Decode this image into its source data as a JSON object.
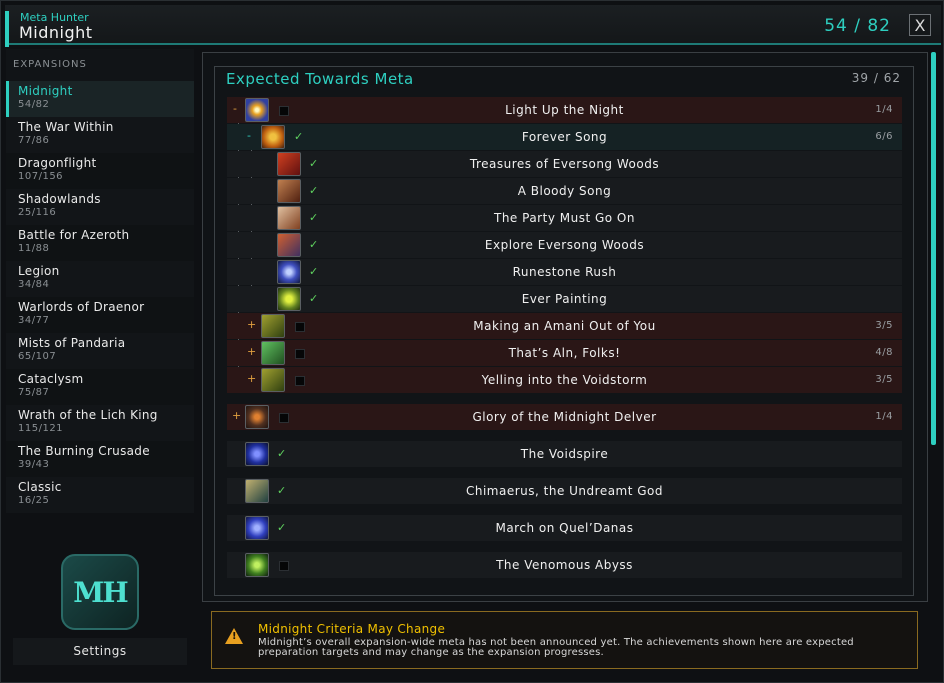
{
  "header": {
    "app_name": "Meta Hunter",
    "title": "Midnight",
    "total_progress": "54 / 82",
    "close_label": "X"
  },
  "sidebar": {
    "header": "EXPANSIONS",
    "items": [
      {
        "name": "Midnight",
        "count": "54/82"
      },
      {
        "name": "The War Within",
        "count": "77/86"
      },
      {
        "name": "Dragonflight",
        "count": "107/156"
      },
      {
        "name": "Shadowlands",
        "count": "25/116"
      },
      {
        "name": "Battle for Azeroth",
        "count": "11/88"
      },
      {
        "name": "Legion",
        "count": "34/84"
      },
      {
        "name": "Warlords of Draenor",
        "count": "34/77"
      },
      {
        "name": "Mists of Pandaria",
        "count": "65/107"
      },
      {
        "name": "Cataclysm",
        "count": "75/87"
      },
      {
        "name": "Wrath of the Lich King",
        "count": "115/121"
      },
      {
        "name": "The Burning Crusade",
        "count": "39/43"
      },
      {
        "name": "Classic",
        "count": "16/25"
      }
    ],
    "logo_text": "MH",
    "settings_label": "Settings"
  },
  "main": {
    "section_title": "Expected Towards Meta",
    "section_count": "39 / 62",
    "rows": [
      {
        "label": "Light Up the Night",
        "progress": "1/4",
        "toggle": "-"
      },
      {
        "label": "Forever Song",
        "progress": "6/6",
        "toggle": "-"
      },
      {
        "label": "Treasures of Eversong Woods"
      },
      {
        "label": "A Bloody Song"
      },
      {
        "label": "The Party Must Go On"
      },
      {
        "label": "Explore Eversong Woods"
      },
      {
        "label": "Runestone Rush"
      },
      {
        "label": "Ever Painting"
      },
      {
        "label": "Making an Amani Out of You",
        "progress": "3/5",
        "toggle": "+"
      },
      {
        "label": "That’s Aln, Folks!",
        "progress": "4/8",
        "toggle": "+"
      },
      {
        "label": "Yelling into the Voidstorm",
        "progress": "3/5",
        "toggle": "+"
      },
      {
        "label": "Glory of the Midnight Delver",
        "progress": "1/4",
        "toggle": "+"
      },
      {
        "label": "The Voidspire"
      },
      {
        "label": "Chimaerus, the Undreamt God"
      },
      {
        "label": "March on Quel’Danas"
      },
      {
        "label": "The Venomous Abyss"
      }
    ],
    "check_mark": "✓"
  },
  "warning": {
    "icon_glyph": "!",
    "title": "Midnight Criteria May Change",
    "body": "Midnight’s overall expansion-wide meta has not been announced yet. The achievements shown here are expected preparation targets and may change as the expansion progresses."
  },
  "colors": {
    "accent": "#2ecfc0",
    "complete_check": "#5fd35f",
    "warning_title": "#f0c000"
  }
}
